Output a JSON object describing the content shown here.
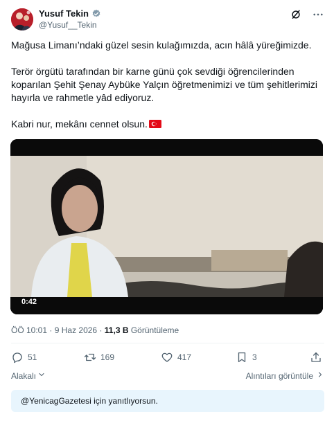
{
  "author": {
    "name": "Yusuf Tekin",
    "handle": "@Yusuf__Tekin"
  },
  "tweet": {
    "line1": "Mağusa Limanı’ndaki güzel sesin kulağımızda, acın hâlâ yüreğimizde.",
    "line2": "Terör örgütü tarafından bir karne günü çok sevdiği öğrencilerinden koparılan Şehit Şenay Aybüke Yalçın öğretmenimizi ve tüm şehitlerimizi hayırla ve rahmetle yâd ediyoruz.",
    "line3": "Kabri nur, mekânı cennet olsun."
  },
  "video": {
    "duration": "0:42"
  },
  "meta": {
    "time": "ÖÖ 10:01",
    "separator": "·",
    "date": "9 Haz 2026",
    "views_count": "11,3 B",
    "views_label": "Görüntüleme"
  },
  "actions": {
    "replies": "51",
    "retweets": "169",
    "likes": "417",
    "bookmarks": "3"
  },
  "replies_bar": {
    "sort_label": "Alakalı",
    "quotes_label": "Alıntıları görüntüle"
  },
  "reply_banner": {
    "text": "@YenicagGazetesi için yanıtlıyorsun."
  },
  "colors": {
    "text_primary": "#0f1419",
    "text_secondary": "#536471",
    "accent": "#1d9bf0",
    "flag_red": "#e30a17",
    "banner_bg": "#e8f5fd"
  },
  "icons": {
    "verified": "verified-badge-icon",
    "grok": "grok-icon",
    "more": "more-icon",
    "reply": "reply-icon",
    "retweet": "retweet-icon",
    "like": "heart-icon",
    "bookmark": "bookmark-icon",
    "share": "share-icon",
    "flag": "turkey-flag-icon"
  }
}
